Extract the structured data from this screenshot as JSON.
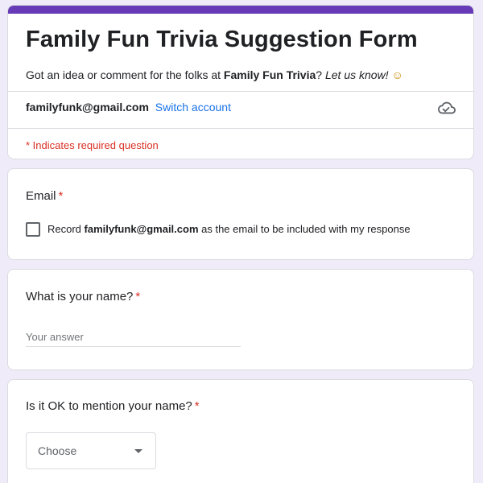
{
  "header": {
    "title": "Family Fun Trivia Suggestion Form",
    "description_prefix": "Got an idea or comment for the folks at ",
    "description_bold": "Family Fun Trivia",
    "description_mid": "? ",
    "description_italic": "Let us know!",
    "description_emoji": "☺",
    "account_email": "familyfunk@gmail.com",
    "switch_account": "Switch account",
    "required_note": "* Indicates required question",
    "accent_color": "#673ab7"
  },
  "questions": {
    "email": {
      "title": "Email",
      "required_mark": "*",
      "checkbox_prefix": "Record ",
      "checkbox_email": "familyfunk@gmail.com",
      "checkbox_suffix": " as the email to be included with my response",
      "checked": false
    },
    "name": {
      "title": "What is your name?",
      "required_mark": "*",
      "placeholder": "Your answer",
      "value": ""
    },
    "mention": {
      "title": "Is it OK to mention your name?",
      "required_mark": "*",
      "selected": "Choose"
    }
  },
  "icons": {
    "cloud": "cloud-done-icon",
    "caret": "caret-down-icon"
  },
  "colors": {
    "background": "#f0ebf8",
    "required": "#d93025",
    "link": "#1a73e8"
  }
}
